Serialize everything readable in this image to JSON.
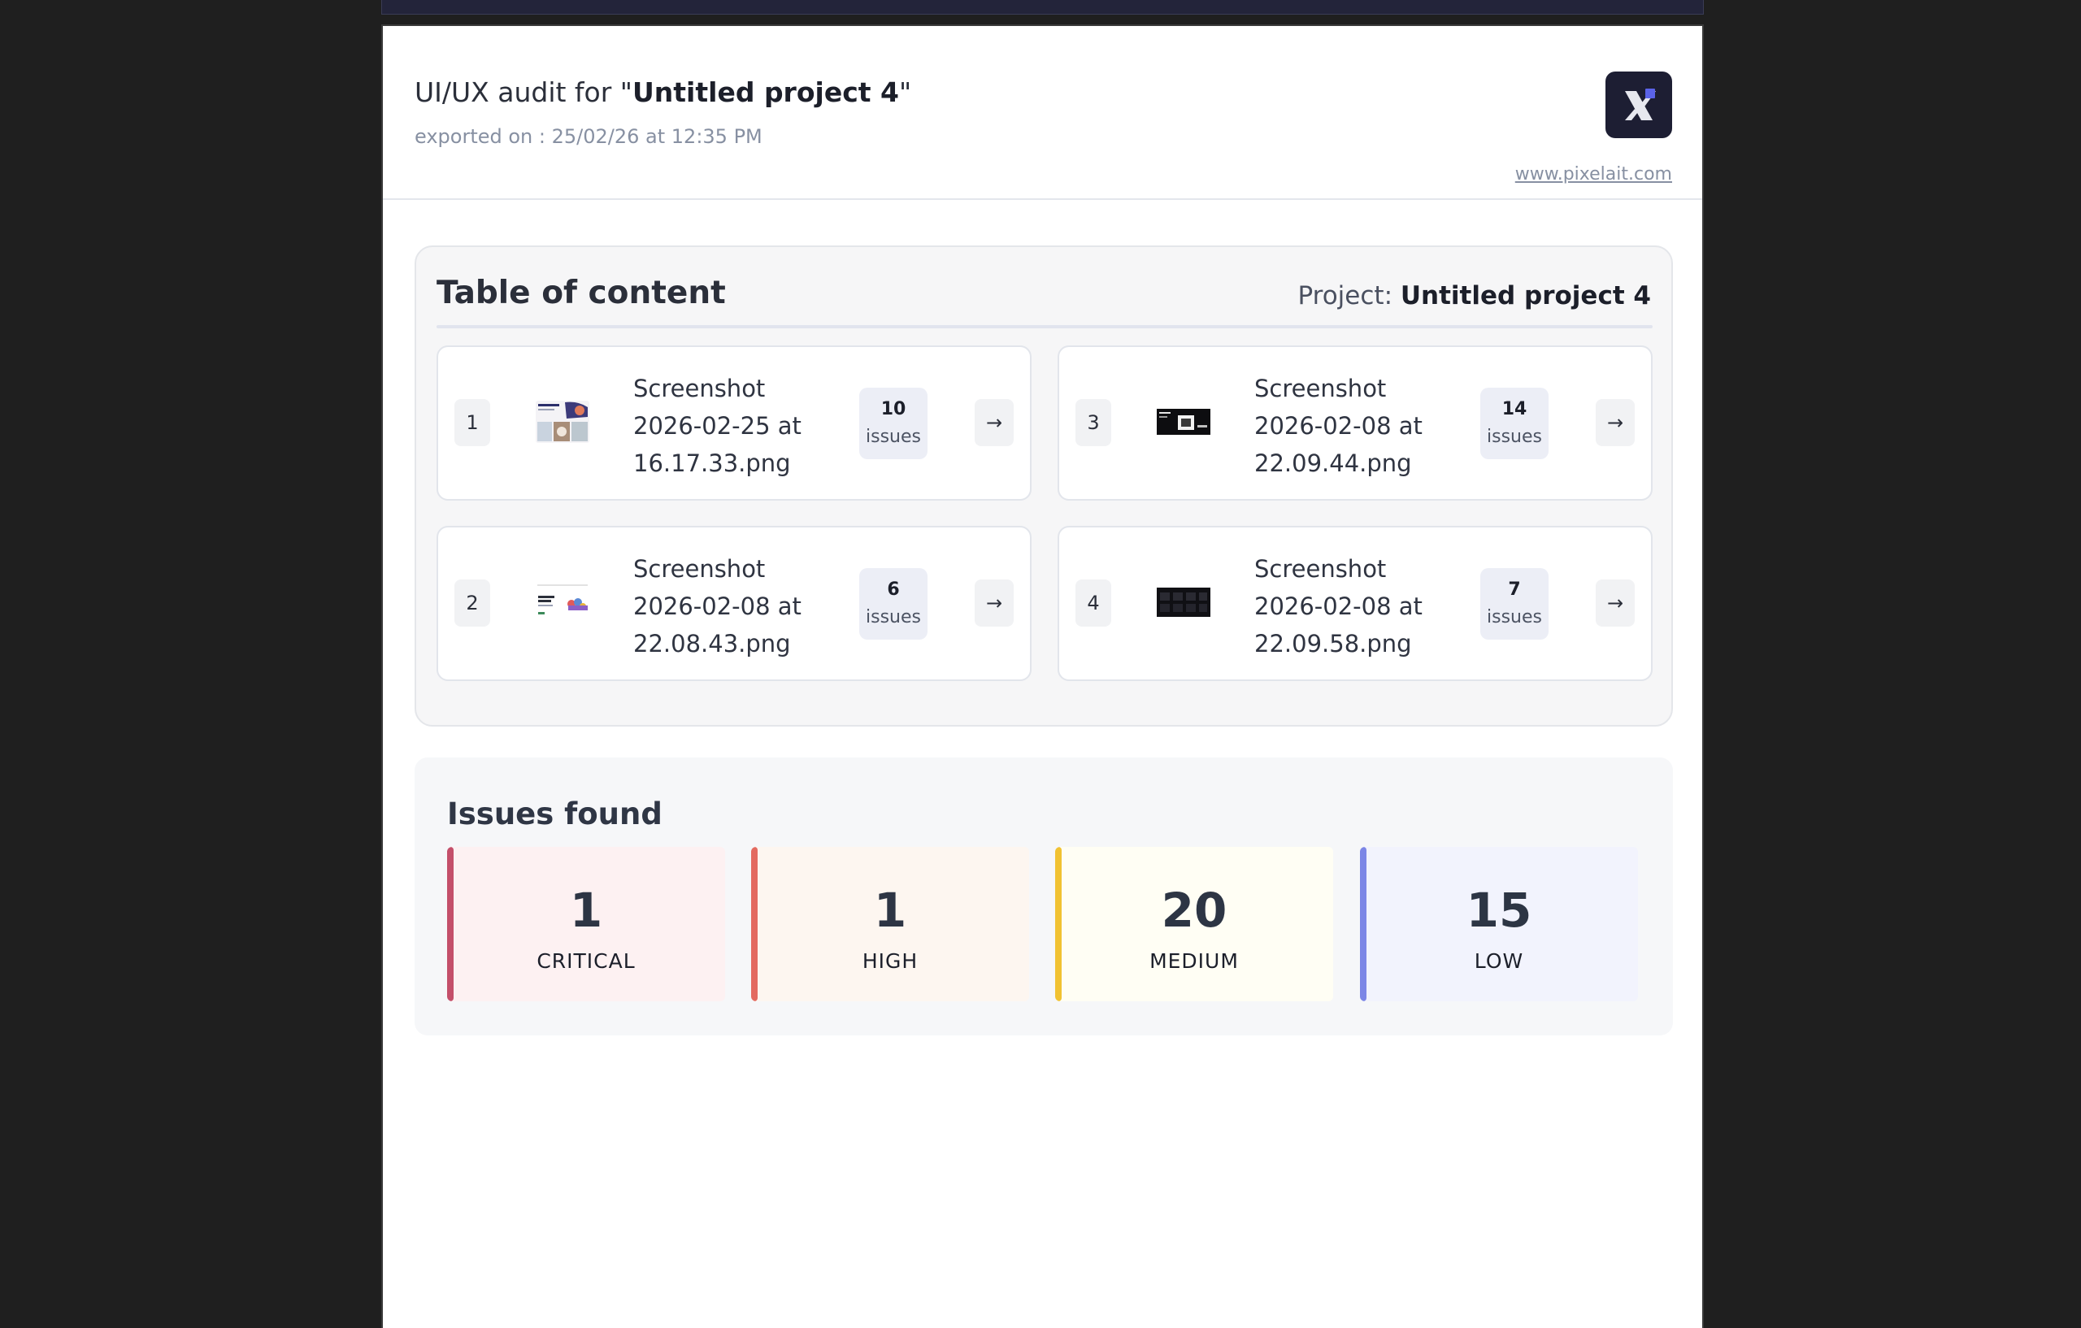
{
  "header": {
    "title_prefix": "UI/UX audit for \"",
    "project_name": "Untitled project 4",
    "title_suffix": "\"",
    "exported": "exported on : 25/02/26 at 12:35 PM",
    "site_link": "www.pixelait.com",
    "logo_icon": "pixelait-logo-icon"
  },
  "toc": {
    "title": "Table of content",
    "project_label": "Project: ",
    "project_name": "Untitled project 4",
    "arrow": "→",
    "items": [
      {
        "index": "1",
        "name": "Screenshot 2026-02-25 at 16.17.33.png",
        "count": "10",
        "count_label": "issues"
      },
      {
        "index": "2",
        "name": "Screenshot 2026-02-08 at 22.08.43.png",
        "count": "6",
        "count_label": "issues"
      },
      {
        "index": "3",
        "name": "Screenshot 2026-02-08 at 22.09.44.png",
        "count": "14",
        "count_label": "issues"
      },
      {
        "index": "4",
        "name": "Screenshot 2026-02-08 at 22.09.58.png",
        "count": "7",
        "count_label": "issues"
      }
    ]
  },
  "issues": {
    "title": "Issues found",
    "severities": [
      {
        "count": "1",
        "label": "CRITICAL",
        "color": "#c44f6a",
        "bg": "#fdf1f2"
      },
      {
        "count": "1",
        "label": "HIGH",
        "color": "#e36a60",
        "bg": "#fdf6f0"
      },
      {
        "count": "20",
        "label": "MEDIUM",
        "color": "#f1c232",
        "bg": "#fffef4"
      },
      {
        "count": "15",
        "label": "LOW",
        "color": "#7c86e6",
        "bg": "#f2f3fd"
      }
    ]
  }
}
